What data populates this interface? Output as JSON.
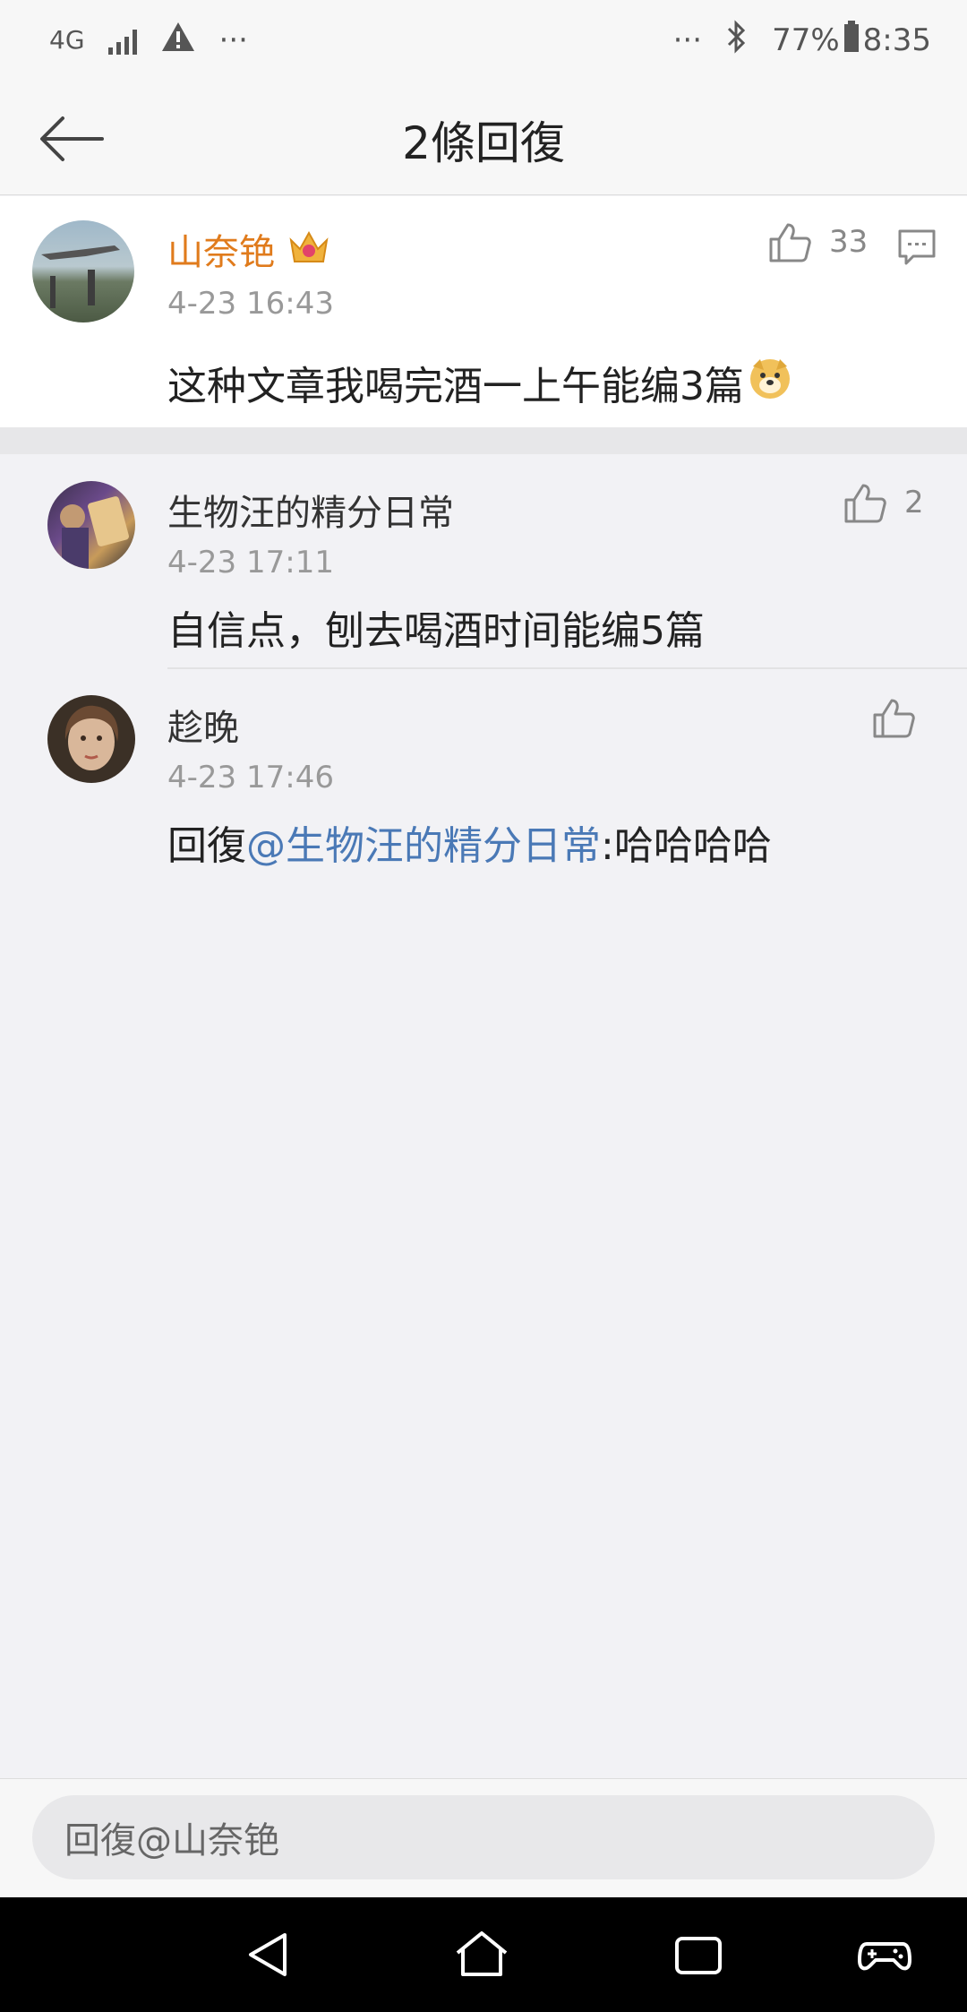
{
  "status_bar": {
    "network": "4G",
    "battery": "77%",
    "time": "8:35",
    "more_left": "···",
    "more_right": "···"
  },
  "header": {
    "title": "2條回復"
  },
  "main_comment": {
    "username": "山奈铯",
    "time": "4-23 16:43",
    "text": "这种文章我喝完酒一上午能编3篇",
    "like_count": "33",
    "username_color": "#e07b1c"
  },
  "replies": [
    {
      "username": "生物汪的精分日常",
      "time": "4-23 17:11",
      "text": "自信点，刨去喝酒时间能编5篇",
      "like_count": "2"
    },
    {
      "username": "趁晚",
      "time": "4-23 17:46",
      "prefix": "回復",
      "mention": "@生物汪的精分日常",
      "suffix": ":哈哈哈哈",
      "like_count": ""
    }
  ],
  "reply_input": {
    "placeholder": "回復@山奈铯"
  },
  "icons": [
    "back-arrow-icon",
    "thumbs-up-icon",
    "comment-icon",
    "crown-badge-icon",
    "doge-emoji-icon",
    "nav-back-icon",
    "nav-home-icon",
    "nav-recent-icon",
    "game-controller-icon"
  ]
}
